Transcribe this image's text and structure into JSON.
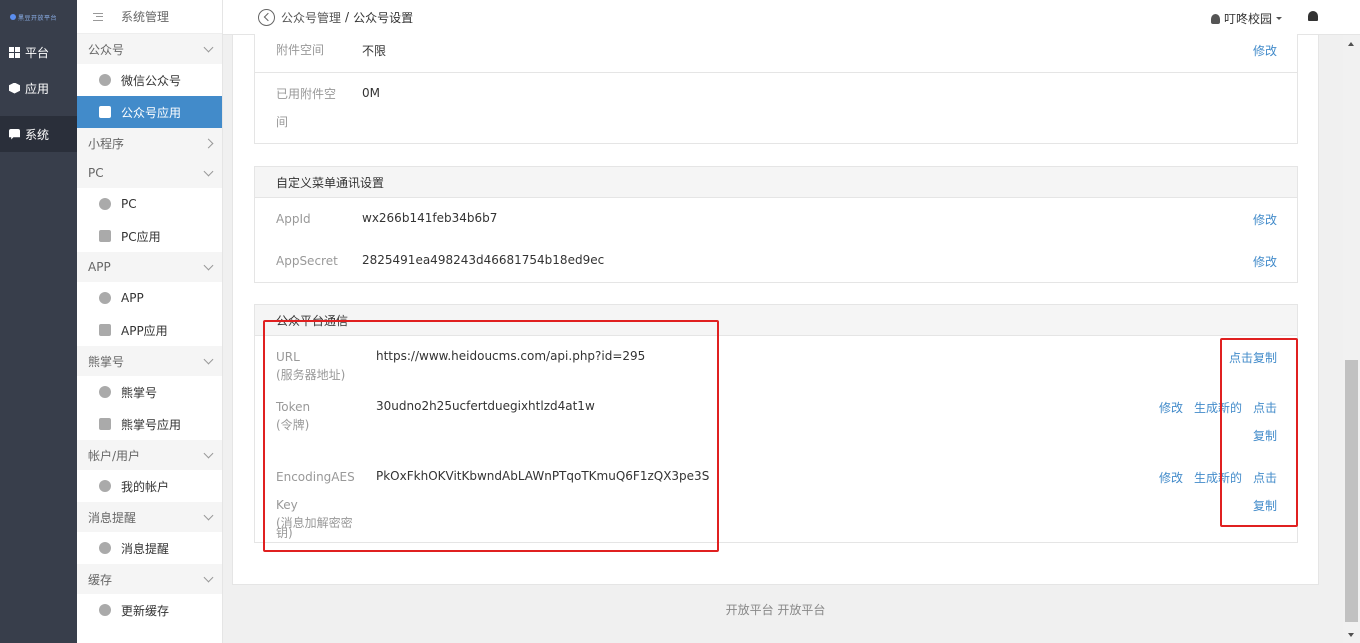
{
  "rail": {
    "logo_text": "黑豆开放平台",
    "items": [
      {
        "label": "平台",
        "icon": "grid-icon"
      },
      {
        "label": "应用",
        "icon": "cube-icon"
      },
      {
        "label": "系统",
        "icon": "system-icon"
      }
    ]
  },
  "sidebar": {
    "title": "系统管理",
    "groups": [
      {
        "label": "公众号",
        "items": [
          {
            "label": "微信公众号"
          },
          {
            "label": "公众号应用"
          }
        ]
      },
      {
        "label": "小程序"
      },
      {
        "label": "PC",
        "items": [
          {
            "label": "PC"
          },
          {
            "label": "PC应用"
          }
        ]
      },
      {
        "label": "APP",
        "items": [
          {
            "label": "APP"
          },
          {
            "label": "APP应用"
          }
        ]
      },
      {
        "label": "熊掌号",
        "items": [
          {
            "label": "熊掌号"
          },
          {
            "label": "熊掌号应用"
          }
        ]
      },
      {
        "label": "帐户/用户",
        "items": [
          {
            "label": "我的帐户"
          }
        ]
      },
      {
        "label": "消息提醒",
        "items": [
          {
            "label": "消息提醒"
          }
        ]
      },
      {
        "label": "缓存",
        "items": [
          {
            "label": "更新缓存"
          }
        ]
      }
    ]
  },
  "header": {
    "breadcrumb_parent": "公众号管理",
    "breadcrumb_sep": "/",
    "breadcrumb_current": "公众号设置",
    "user_name": "叮咚校园"
  },
  "attach": {
    "space_label": "附件空间",
    "space_value": "不限",
    "space_action": "修改",
    "used_label_1": "已用附件空",
    "used_label_2": "间",
    "used_value": "0M"
  },
  "menu_comm": {
    "title": "自定义菜单通讯设置",
    "appid_label": "AppId",
    "appid_value": "wx266b141feb34b6b7",
    "appid_action": "修改",
    "secret_label": "AppSecret",
    "secret_value": "2825491ea498243d46681754b18ed9ec",
    "secret_action": "修改"
  },
  "platform_comm": {
    "title": "公众平台通信",
    "url_label_1": "URL",
    "url_label_2": "(服务器地址)",
    "url_value": "https://www.heidoucms.com/api.php?id=295",
    "url_copy": "点击复制",
    "token_label_1": "Token",
    "token_label_2": "(令牌)",
    "token_value": "30udno2h25ucfertduegixhtlzd4at1w",
    "token_modify": "修改",
    "token_generate": "生成新的",
    "token_copy_1": "点击",
    "token_copy_2": "复制",
    "aes_label_1": "EncodingAES",
    "aes_label_2": "Key",
    "aes_label_3": "(消息加解密密",
    "aes_label_4": "钥)",
    "aes_value": "PkOxFkhOKVitKbwndAbLAWnPTqoTKmuQ6F1zQX3pe3S",
    "aes_modify": "修改",
    "aes_generate": "生成新的",
    "aes_copy_1": "点击",
    "aes_copy_2": "复制"
  },
  "footer": {
    "text": "开放平台 开放平台"
  },
  "colors": {
    "accent": "#428bca",
    "rail": "#383e4b",
    "highlight_box": "#e02020"
  }
}
